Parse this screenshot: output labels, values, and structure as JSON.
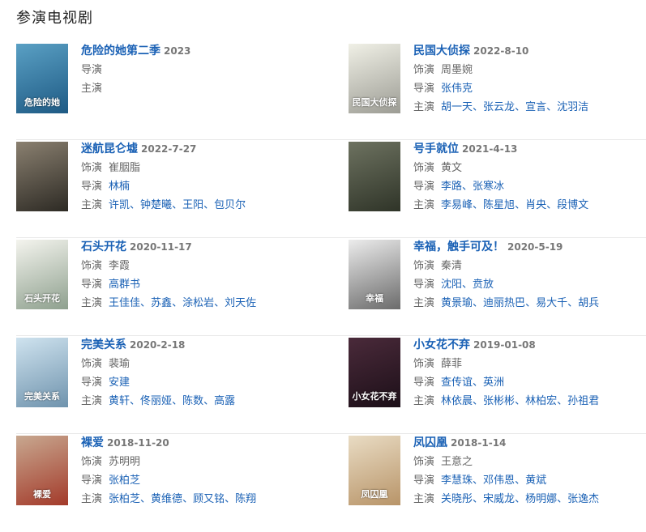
{
  "section": {
    "title": "参演电视剧"
  },
  "labels": {
    "actor": "饰演",
    "director": "导演",
    "cast": "主演"
  },
  "dramas": [
    {
      "title": "危险的她第二季",
      "date": "2023",
      "role": "",
      "directors": [],
      "cast": [],
      "poster_text": "危险的她",
      "poster_colors": [
        "#5aa0c4",
        "#1e5a84"
      ]
    },
    {
      "title": "民国大侦探",
      "date": "2022-8-10",
      "role": "周墨婉",
      "directors": [
        "张伟克"
      ],
      "cast": [
        "胡一天",
        "张云龙",
        "宣言",
        "沈羽洁"
      ],
      "poster_text": "民国大侦探",
      "poster_colors": [
        "#f0f0e6",
        "#9c9c94"
      ]
    },
    {
      "title": "迷航昆仑墟",
      "date": "2022-7-27",
      "role": "崔胭脂",
      "directors": [
        "林楠"
      ],
      "cast": [
        "许凯",
        "钟楚曦",
        "王阳",
        "包贝尔"
      ],
      "poster_text": "",
      "poster_colors": [
        "#8a8070",
        "#2d2a24"
      ]
    },
    {
      "title": "号手就位",
      "date": "2021-4-13",
      "role": "黄文",
      "directors": [
        "李路",
        "张寒冰"
      ],
      "cast": [
        "李易峰",
        "陈星旭",
        "肖央",
        "段博文"
      ],
      "poster_text": "",
      "poster_colors": [
        "#6d7260",
        "#2f3428"
      ]
    },
    {
      "title": "石头开花",
      "date": "2020-11-17",
      "role": "李霞",
      "directors": [
        "高群书"
      ],
      "cast": [
        "王佳佳",
        "苏鑫",
        "涂松岩",
        "刘天佐"
      ],
      "poster_text": "石头开花",
      "poster_colors": [
        "#f4f4ee",
        "#8ea08e"
      ]
    },
    {
      "title": "幸福，触手可及！",
      "date": "2020-5-19",
      "role": "秦清",
      "directors": [
        "沈阳",
        "贲放"
      ],
      "cast": [
        "黄景瑜",
        "迪丽热巴",
        "易大千",
        "胡兵"
      ],
      "poster_text": "幸福",
      "poster_colors": [
        "#ececec",
        "#6b6b6b"
      ]
    },
    {
      "title": "完美关系",
      "date": "2020-2-18",
      "role": "裴瑜",
      "directors": [
        "安建"
      ],
      "cast": [
        "黄轩",
        "佟丽娅",
        "陈数",
        "高露"
      ],
      "poster_text": "完美关系",
      "poster_colors": [
        "#cfe3ef",
        "#6f93ad"
      ]
    },
    {
      "title": "小女花不弃",
      "date": "2019-01-08",
      "role": "薛菲",
      "directors": [
        "查传谊",
        "英洲"
      ],
      "cast": [
        "林依晨",
        "张彬彬",
        "林柏宏",
        "孙祖君"
      ],
      "poster_text": "小女花不弃",
      "poster_colors": [
        "#4a2a3a",
        "#1c0f18"
      ]
    },
    {
      "title": "裸爱",
      "date": "2018-11-20",
      "role": "苏明明",
      "directors": [
        "张柏芝"
      ],
      "cast": [
        "张柏芝",
        "黄维德",
        "顾又铭",
        "陈翔"
      ],
      "poster_text": "裸爱",
      "poster_colors": [
        "#c8a890",
        "#a33a2a"
      ]
    },
    {
      "title": "凤囚凰",
      "date": "2018-1-14",
      "role": "王意之",
      "directors": [
        "李慧珠",
        "邓伟恩",
        "黄斌"
      ],
      "cast": [
        "关晓彤",
        "宋威龙",
        "杨明娜",
        "张逸杰"
      ],
      "poster_text": "凤囚凰",
      "poster_colors": [
        "#e9dcc4",
        "#b89468"
      ]
    }
  ]
}
